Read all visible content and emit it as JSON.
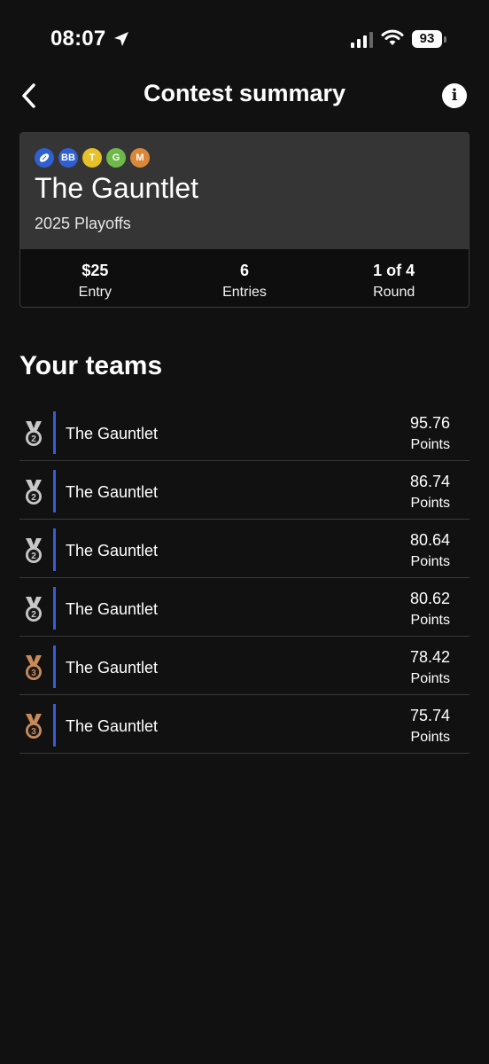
{
  "status": {
    "time": "08:07",
    "battery": "93",
    "icons": [
      "location-arrow-icon",
      "signal-icon",
      "wifi-icon",
      "battery-icon"
    ]
  },
  "header": {
    "title": "Contest summary",
    "back_icon": "chevron-left-icon",
    "info_icon": "info-icon"
  },
  "contest": {
    "sport_badges": [
      {
        "label": "",
        "icon": "football-icon",
        "color": "#2f5fd0"
      },
      {
        "label": "BB",
        "color": "#2f5fd0"
      },
      {
        "label": "T",
        "color": "#e6c12a"
      },
      {
        "label": "G",
        "color": "#6fb84a"
      },
      {
        "label": "M",
        "color": "#d9883a"
      }
    ],
    "name": "The Gauntlet",
    "subtitle": "2025 Playoffs",
    "stats": [
      {
        "value": "$25",
        "label": "Entry"
      },
      {
        "value": "6",
        "label": "Entries"
      },
      {
        "value": "1 of 4",
        "label": "Round"
      }
    ]
  },
  "teams": {
    "title": "Your teams",
    "points_label": "Points",
    "rows": [
      {
        "medal": "2",
        "medal_type": "silver",
        "name": "The Gauntlet",
        "points": "95.76"
      },
      {
        "medal": "2",
        "medal_type": "silver",
        "name": "The Gauntlet",
        "points": "86.74"
      },
      {
        "medal": "2",
        "medal_type": "silver",
        "name": "The Gauntlet",
        "points": "80.64"
      },
      {
        "medal": "2",
        "medal_type": "silver",
        "name": "The Gauntlet",
        "points": "80.62"
      },
      {
        "medal": "3",
        "medal_type": "bronze",
        "name": "The Gauntlet",
        "points": "78.42"
      },
      {
        "medal": "3",
        "medal_type": "bronze",
        "name": "The Gauntlet",
        "points": "75.74"
      }
    ]
  },
  "colors": {
    "background": "#111111",
    "card_top": "#353535",
    "accent_bar": "#3b5bd6",
    "silver": "#c8c8c8",
    "bronze": "#c98a5a"
  }
}
